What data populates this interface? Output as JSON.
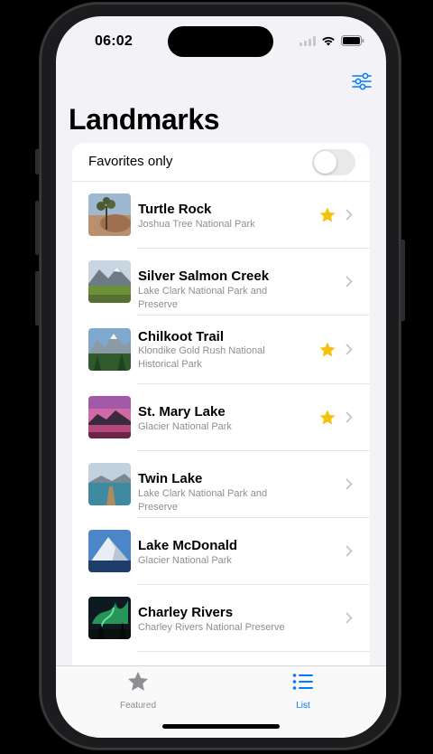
{
  "status_bar": {
    "time": "06:02"
  },
  "nav": {
    "title": "Landmarks",
    "filter_icon": "slider-horizontal-icon"
  },
  "favorites_toggle": {
    "label": "Favorites only",
    "on": false
  },
  "landmarks": [
    {
      "name": "Turtle Rock",
      "park": "Joshua Tree National Park",
      "favorite": true
    },
    {
      "name": "Silver Salmon Creek",
      "park": "Lake Clark National Park and Preserve",
      "favorite": false
    },
    {
      "name": "Chilkoot Trail",
      "park": "Klondike Gold Rush National Historical Park",
      "favorite": true
    },
    {
      "name": "St. Mary Lake",
      "park": "Glacier National Park",
      "favorite": true
    },
    {
      "name": "Twin Lake",
      "park": "Lake Clark National Park and Preserve",
      "favorite": false
    },
    {
      "name": "Lake McDonald",
      "park": "Glacier National Park",
      "favorite": false
    },
    {
      "name": "Charley Rivers",
      "park": "Charley Rivers National Preserve",
      "favorite": false
    }
  ],
  "tabs": [
    {
      "label": "Featured",
      "icon": "star-icon",
      "selected": false
    },
    {
      "label": "List",
      "icon": "list-icon",
      "selected": true
    }
  ],
  "colors": {
    "accent": "#007aff",
    "star": "#f4c20d",
    "inactive": "#8e8e93"
  }
}
